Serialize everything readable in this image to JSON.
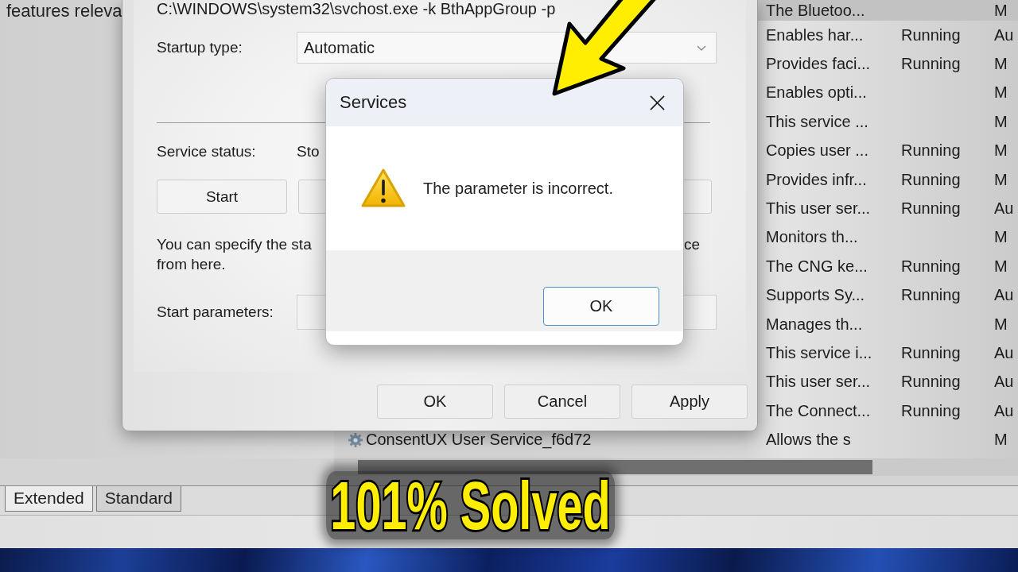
{
  "services_console": {
    "description_pane_text": "features releva",
    "services_list": {
      "rows": [
        {
          "description": "The Bluetoo...",
          "startup_type": "M",
          "selected": true
        },
        {
          "description": "Enables har...",
          "status": "Running",
          "startup_type": "Au",
          "selected": false
        },
        {
          "description": "Provides faci...",
          "status": "Running",
          "startup_type": "M",
          "selected": false
        },
        {
          "description": "Enables opti...",
          "startup_type": "M",
          "selected": false
        },
        {
          "description": "This service ...",
          "startup_type": "M",
          "selected": false
        },
        {
          "description": "Copies user ...",
          "status": "Running",
          "startup_type": "M",
          "selected": false
        },
        {
          "description": "Provides infr...",
          "status": "Running",
          "startup_type": "M",
          "selected": false
        },
        {
          "description": "This user ser...",
          "status": "Running",
          "startup_type": "Au",
          "selected": false
        },
        {
          "description": "Monitors th...",
          "startup_type": "M",
          "selected": false
        },
        {
          "description": "The CNG ke...",
          "status": "Running",
          "startup_type": "M",
          "selected": false
        },
        {
          "description": "Supports Sy...",
          "status": "Running",
          "startup_type": "Au",
          "selected": false
        },
        {
          "description": "Manages th...",
          "startup_type": "M",
          "selected": false
        },
        {
          "description": "This service i...",
          "status": "Running",
          "startup_type": "Au",
          "selected": false
        },
        {
          "description": "This user ser...",
          "status": "Running",
          "startup_type": "Au",
          "selected": false
        },
        {
          "description": "The Connect...",
          "status": "Running",
          "startup_type": "Au",
          "selected": false
        },
        {
          "name": "ConsentUX User Service_f6d72",
          "description": "Allows the s",
          "startup_type": "M",
          "selected": false
        }
      ]
    },
    "view_tabs": [
      {
        "label": "Extended",
        "selected": true
      },
      {
        "label": "Standard",
        "selected": false
      }
    ]
  },
  "properties_dialog": {
    "executable_path": "C:\\WINDOWS\\system32\\svchost.exe -k BthAppGroup -p",
    "startup_type": {
      "label": "Startup type:",
      "value": "Automatic"
    },
    "service_status": {
      "label": "Service status:",
      "value": "Sto"
    },
    "service_buttons": [
      {
        "kind": "labeled",
        "label": "Start"
      },
      {
        "kind": "covered"
      },
      {
        "kind": "covered"
      }
    ],
    "hint_text": {
      "line_1_start": "You can specify the sta",
      "line_1_end": "ce",
      "line_2": "from here."
    },
    "start_parameters": {
      "label": "Start parameters:"
    },
    "buttons": [
      "OK",
      "Cancel",
      "Apply"
    ]
  },
  "message_box": {
    "title": "Services",
    "message": "The parameter is incorrect.",
    "buttons": [
      "OK"
    ]
  },
  "caption": "101% Solved"
}
